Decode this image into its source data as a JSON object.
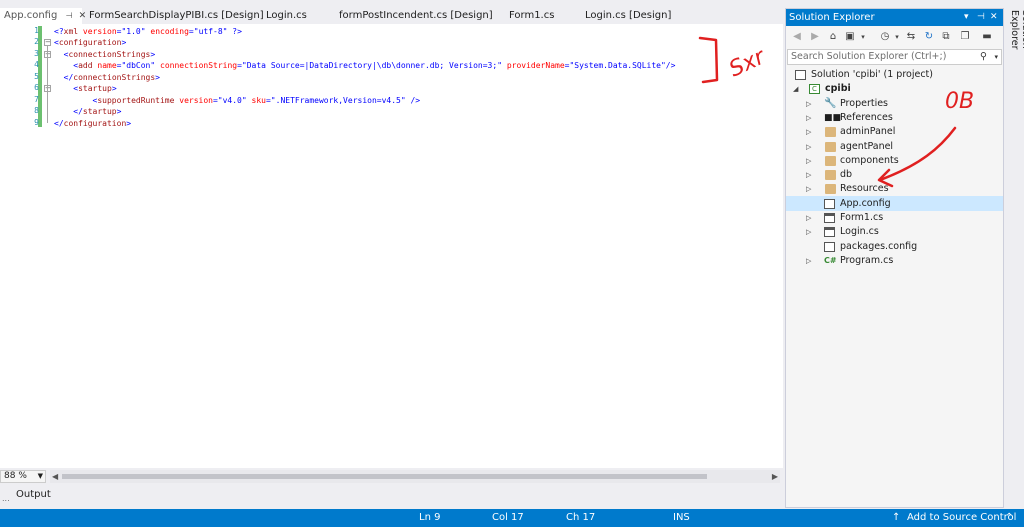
{
  "editor": {
    "tabs": [
      {
        "label": "App.config",
        "active": true
      },
      {
        "label": "FormSearchDisplayPIBI.cs [Design]"
      },
      {
        "label": "Login.cs"
      },
      {
        "label": "formPostIncendent.cs [Design]"
      },
      {
        "label": "Form1.cs"
      },
      {
        "label": "Login.cs [Design]"
      }
    ],
    "line_numbers": [
      "1",
      "2",
      "3",
      "4",
      "5",
      "6",
      "7",
      "8",
      "9"
    ],
    "lines": [
      "<?xml version=\"1.0\" encoding=\"utf-8\" ?>",
      "<configuration>",
      "  <connectionStrings>",
      "    <add name=\"dbCon\" connectionString=\"Data Source=|DataDirectory|\\db\\donner.db; Version=3;\" providerName=\"System.Data.SQLite\"/>",
      "  </connectionStrings>",
      "    <startup>",
      "        <supportedRuntime version=\"v4.0\" sku=\".NETFramework,Version=v4.5\" />",
      "    </startup>",
      "</configuration>"
    ],
    "zoom": "88 %"
  },
  "output": {
    "tab_label": "Output",
    "dots": "..."
  },
  "status_bar": {
    "ln": "Ln 9",
    "col": "Col 17",
    "ch": "Ch 17",
    "mode": "INS",
    "source_control": "Add to Source Control",
    "bg_color": "#007acc"
  },
  "solution_explorer": {
    "title": "Solution Explorer",
    "side_tab": "Solution Explorer",
    "search_placeholder": "Search Solution Explorer (Ctrl+;)",
    "tree": {
      "solution": "Solution 'cpibi' (1 project)",
      "project": "cpibi",
      "items": [
        {
          "label": "Properties",
          "icon": "wrench-icon"
        },
        {
          "label": "References",
          "icon": "references-icon"
        },
        {
          "label": "adminPanel",
          "icon": "folder-icon"
        },
        {
          "label": "agentPanel",
          "icon": "folder-icon"
        },
        {
          "label": "components",
          "icon": "folder-icon"
        },
        {
          "label": "db",
          "icon": "folder-icon"
        },
        {
          "label": "Resources",
          "icon": "folder-icon"
        },
        {
          "label": "App.config",
          "icon": "config-file-icon",
          "selected": true
        },
        {
          "label": "Form1.cs",
          "icon": "form-file-icon"
        },
        {
          "label": "Login.cs",
          "icon": "form-file-icon"
        },
        {
          "label": "packages.config",
          "icon": "config-file-icon"
        },
        {
          "label": "Program.cs",
          "icon": "csharp-file-icon"
        }
      ]
    },
    "accent_color": "#007acc",
    "selection_color": "#cce8ff"
  },
  "annotations": {
    "bracket_text": "Sxr",
    "folder_mark": "0B",
    "ink_color": "#e02020"
  }
}
